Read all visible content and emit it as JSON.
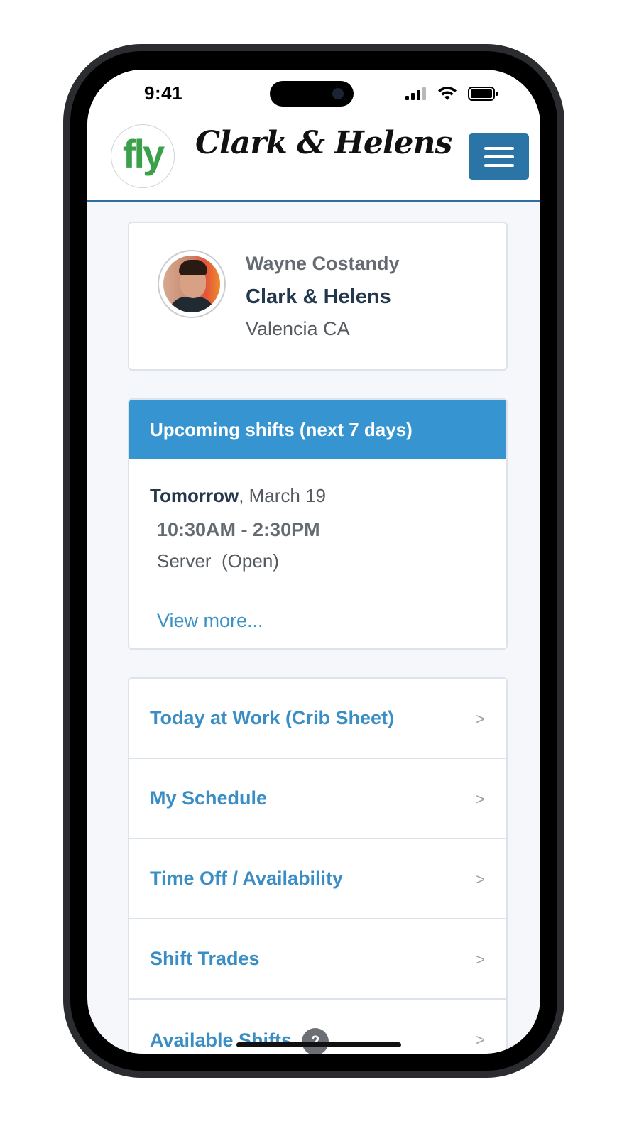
{
  "status_bar": {
    "time": "9:41"
  },
  "header": {
    "logo_text": "fly",
    "brand_name": "Clark & Helens"
  },
  "profile": {
    "name": "Wayne Costandy",
    "company": "Clark & Helens",
    "location": "Valencia CA"
  },
  "shifts": {
    "title": "Upcoming shifts (next 7 days)",
    "day_label": "Tomorrow",
    "date_suffix": ", March 19",
    "time_range": "10:30AM - 2:30PM",
    "role": "Server  (Open)",
    "view_more": "View more..."
  },
  "menu": {
    "chevron": ">",
    "items": [
      {
        "label": "Today at Work (Crib Sheet)"
      },
      {
        "label": "My Schedule"
      },
      {
        "label": "Time Off / Availability"
      },
      {
        "label": "Shift Trades"
      },
      {
        "label": "Available Shifts",
        "badge": "2"
      }
    ]
  },
  "colors": {
    "primary_blue": "#2a74a6",
    "header_blue": "#3695d1",
    "link_blue": "#3a8ec4",
    "logo_green": "#3aa04a"
  }
}
